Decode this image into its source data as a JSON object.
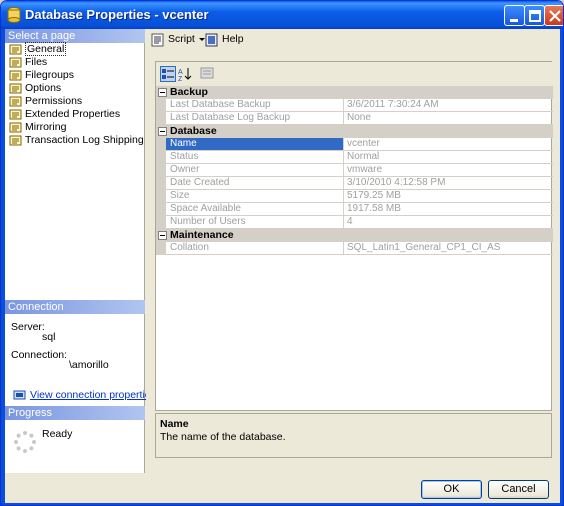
{
  "window": {
    "title": "Database Properties - vcenter"
  },
  "left": {
    "select_header": "Select a page",
    "pages": [
      {
        "label": "General",
        "selected": true
      },
      {
        "label": "Files"
      },
      {
        "label": "Filegroups"
      },
      {
        "label": "Options"
      },
      {
        "label": "Permissions"
      },
      {
        "label": "Extended Properties"
      },
      {
        "label": "Mirroring"
      },
      {
        "label": "Transaction Log Shipping"
      }
    ],
    "connection": {
      "header": "Connection",
      "server_label": "Server:",
      "server_value": "sql",
      "connection_label": "Connection:",
      "connection_value": "\\amorillo",
      "link": "View connection properties"
    },
    "progress": {
      "header": "Progress",
      "status": "Ready"
    }
  },
  "toolbar": {
    "script_label": "Script",
    "help_label": "Help"
  },
  "grid": {
    "categories": [
      {
        "label": "Backup",
        "rows": [
          {
            "name": "Last Database Backup",
            "value": "3/6/2011 7:30:24 AM"
          },
          {
            "name": "Last Database Log Backup",
            "value": "None"
          }
        ]
      },
      {
        "label": "Database",
        "rows": [
          {
            "name": "Name",
            "value": "vcenter",
            "selected": true
          },
          {
            "name": "Status",
            "value": "Normal"
          },
          {
            "name": "Owner",
            "value": "vmware"
          },
          {
            "name": "Date Created",
            "value": "3/10/2010 4:12:58 PM"
          },
          {
            "name": "Size",
            "value": "5179.25 MB"
          },
          {
            "name": "Space Available",
            "value": "1917.58 MB"
          },
          {
            "name": "Number of Users",
            "value": "4"
          }
        ]
      },
      {
        "label": "Maintenance",
        "rows": [
          {
            "name": "Collation",
            "value": "SQL_Latin1_General_CP1_CI_AS"
          }
        ]
      }
    ]
  },
  "description": {
    "title": "Name",
    "text": "The name of the database."
  },
  "buttons": {
    "ok": "OK",
    "cancel": "Cancel"
  }
}
